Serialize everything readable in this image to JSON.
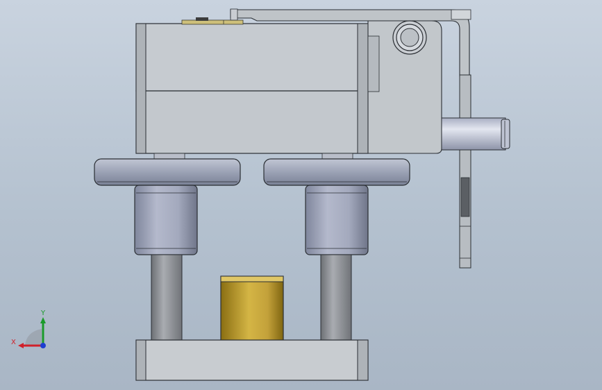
{
  "viewport": {
    "background_top": "#c9d3df",
    "background_bottom": "#a9b6c5"
  },
  "parts": {
    "housing": {
      "fill": "#c6cbd0",
      "edge": "#2a2e33"
    },
    "bracket": {
      "fill": "#bfc4c8"
    },
    "roller_wheels": {
      "count": 2,
      "fill": "#9ea5b6"
    },
    "sleeves": {
      "count": 2,
      "fill": "#a2a8bc"
    },
    "guide_posts": {
      "count": 2,
      "fill": "#8e9196"
    },
    "brass_bushing": {
      "fill": "#c2a23a"
    },
    "shaft": {
      "fill": "#c7ccdb"
    },
    "base_block": {
      "fill": "#c8ccd0"
    },
    "top_plate": {
      "fill": "#cdbf7a"
    }
  },
  "triad": {
    "x_label": "X",
    "y_label": "Y",
    "x_color": "#d0202a",
    "y_color": "#1a9a2a",
    "z_color": "#1f3fd0"
  }
}
